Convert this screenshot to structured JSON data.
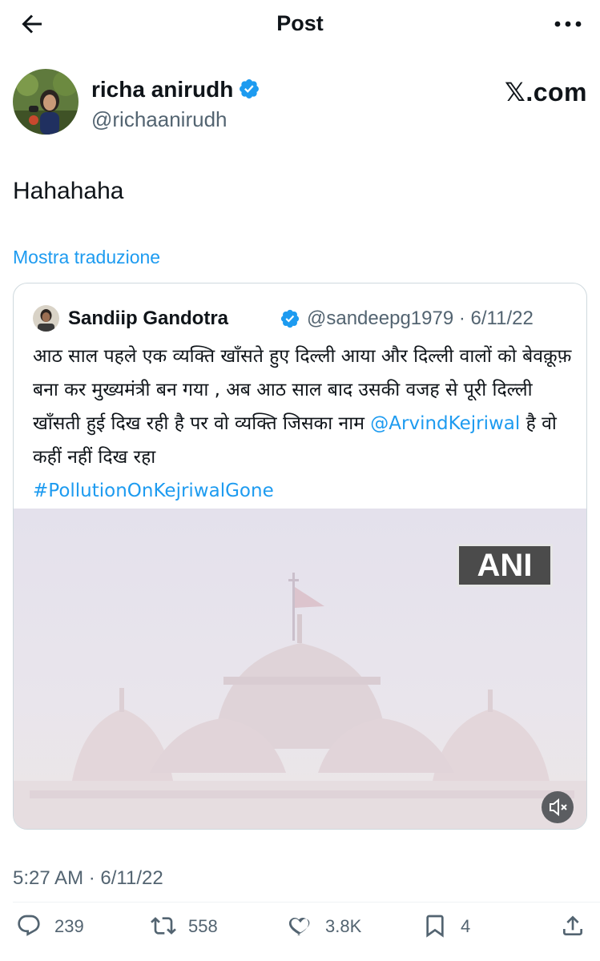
{
  "header": {
    "title": "Post"
  },
  "tweet": {
    "author_name": "richa anirudh",
    "author_handle": "@richaanirudh",
    "text": "Hahahaha",
    "translate_label": "Mostra traduzione",
    "watermark": "𝕏.com",
    "timestamp": "5:27 AM · 6/11/22"
  },
  "quote": {
    "author_name": "Sandiip Gandotra",
    "meta": "@sandeepg1979 · 6/11/22",
    "text_before": "आठ साल पहले एक व्यक्ति खाँसते हुए दिल्ली आया और दिल्ली वालों को बेवक़ूफ़ बना कर मुख्यमंत्री बन गया , अब आठ साल बाद उसकी वजह से पूरी दिल्ली खाँसती हुई दिख रही है पर वो व्यक्ति जिसका नाम ",
    "mention": "@ArvindKejriwal",
    "text_after": " है वो कहीं नहीं दिख रहा ",
    "hashtag": "#PollutionOnKejriwalGone",
    "media_badge": "ANI"
  },
  "actions": {
    "replies": "239",
    "reposts": "558",
    "likes": "3.8K",
    "bookmarks": "4"
  },
  "colors": {
    "accent": "#1d9bf0",
    "muted_text": "#536471",
    "border": "#cfd9de"
  }
}
